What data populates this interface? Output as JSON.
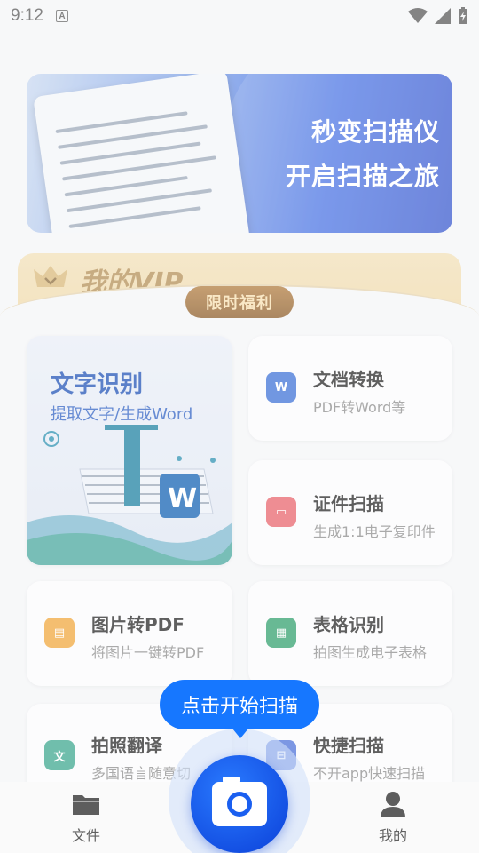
{
  "status_bar": {
    "time": "9:12",
    "notification_icon": "A"
  },
  "banner": {
    "line1": "秒变扫描仪",
    "line2": "开启扫描之旅"
  },
  "vip": {
    "title": "我的VIP",
    "button": "限时福利"
  },
  "features": {
    "text_recognition": {
      "title": "文字识别",
      "subtitle": "提取文字/生成Word"
    },
    "doc_convert": {
      "title": "文档转换",
      "subtitle": "PDF转Word等",
      "icon": "word-icon"
    },
    "id_scan": {
      "title": "证件扫描",
      "subtitle": "生成1:1电子复印件",
      "icon": "id-card-icon"
    },
    "img_to_pdf": {
      "title": "图片转PDF",
      "subtitle": "将图片一键转PDF",
      "icon": "pdf-icon"
    },
    "table_recognition": {
      "title": "表格识别",
      "subtitle": "拍图生成电子表格",
      "icon": "table-icon"
    },
    "photo_translate": {
      "title": "拍照翻译",
      "subtitle": "多国语言随意切",
      "icon": "translate-icon"
    },
    "quick_scan": {
      "title": "快捷扫描",
      "subtitle": "不开app快速扫描",
      "icon": "quick-scan-icon"
    }
  },
  "tooltip": "点击开始扫描",
  "bottom_nav": {
    "files": "文件",
    "mine": "我的"
  },
  "colors": {
    "accent_blue": "#1677ff",
    "vip_gold": "#b28d52",
    "banner_blue": "#1b3fc6"
  }
}
